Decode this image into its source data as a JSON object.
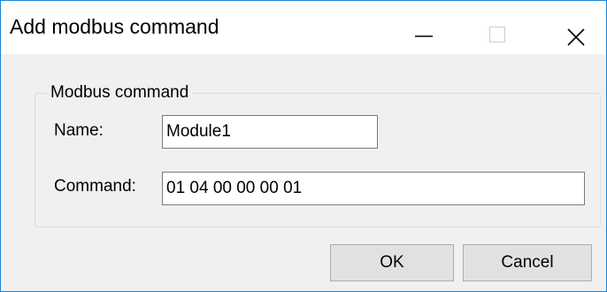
{
  "window": {
    "title": "Add modbus command",
    "controls": {
      "minimize_icon": "minimize-icon",
      "maximize_icon": "maximize-icon",
      "close_icon": "close-icon"
    },
    "accent_border_color": "#1883d7"
  },
  "group": {
    "legend": "Modbus command"
  },
  "fields": {
    "name_label": "Name:",
    "name_value": "Module1",
    "command_label": "Command:",
    "command_value": "01 04 00 00 00 01"
  },
  "buttons": {
    "ok_label": "OK",
    "cancel_label": "Cancel"
  }
}
